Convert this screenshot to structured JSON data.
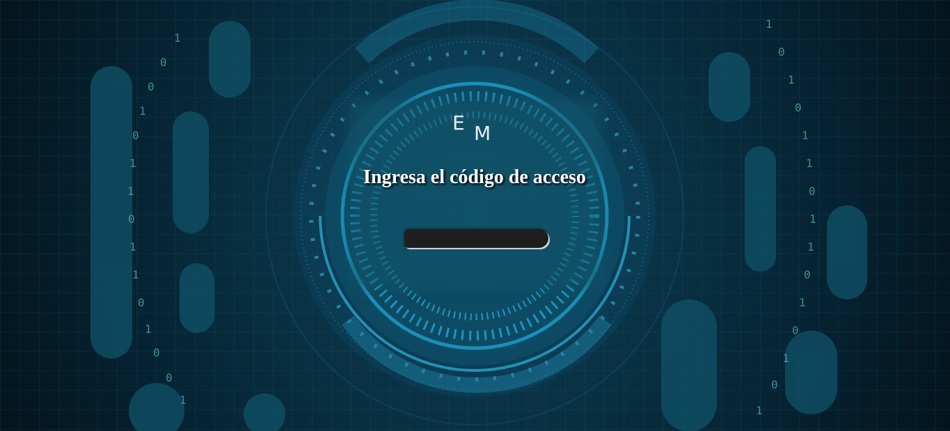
{
  "logo": {
    "letter1": "E",
    "letter2": "M"
  },
  "heading": "Ingresa el código de acceso",
  "code_input": {
    "value": "",
    "placeholder": ""
  },
  "colors": {
    "background": "#0a3346",
    "accent": "#1fa7d6",
    "text": "#ffffff",
    "input": "#1e1e1e"
  }
}
